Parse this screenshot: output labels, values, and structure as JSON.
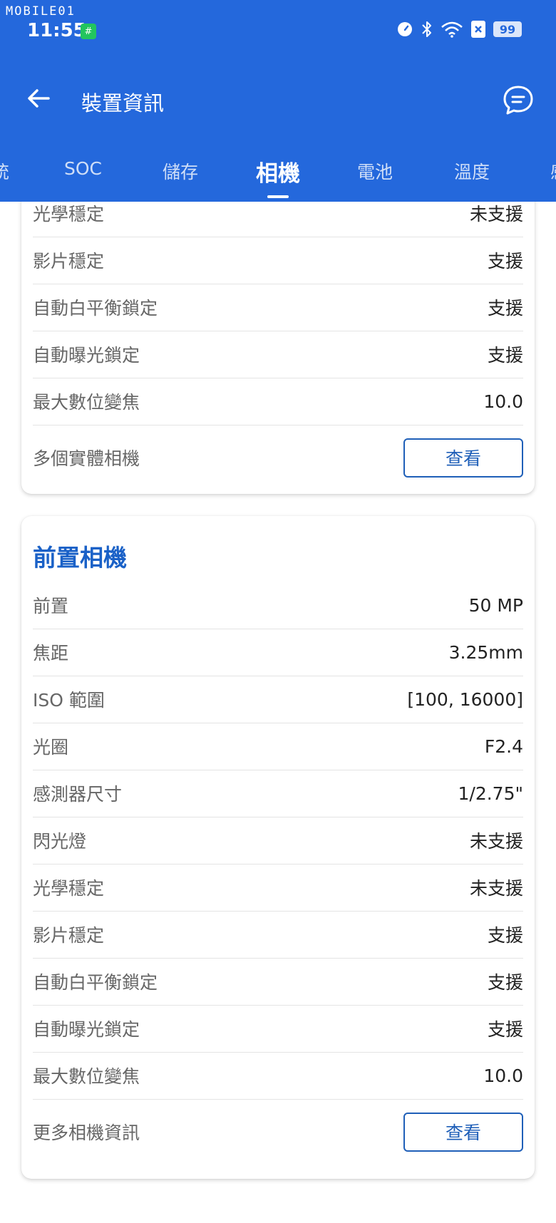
{
  "status": {
    "brand": "MOBILE01",
    "time": "11:55",
    "battery": "99",
    "icons": [
      "speed-icon",
      "bluetooth-icon",
      "wifi-icon",
      "sim-x-icon"
    ]
  },
  "toolbar": {
    "title": "裝置資訊"
  },
  "tabs": [
    "統",
    "SOC",
    "儲存",
    "相機",
    "電池",
    "溫度",
    "感"
  ],
  "active_tab": "相機",
  "top_card": {
    "rows": [
      {
        "label": "光學穩定",
        "value": "未支援"
      },
      {
        "label": "影片穩定",
        "value": "支援"
      },
      {
        "label": "自動白平衡鎖定",
        "value": "支援"
      },
      {
        "label": "自動曝光鎖定",
        "value": "支援"
      },
      {
        "label": "最大數位變焦",
        "value": "10.0"
      }
    ],
    "action": {
      "label": "多個實體相機",
      "button": "查看"
    }
  },
  "front_card": {
    "title": "前置相機",
    "rows": [
      {
        "label": "前置",
        "value": "50 MP"
      },
      {
        "label": "焦距",
        "value": "3.25mm"
      },
      {
        "label": "ISO 範圍",
        "value": "[100, 16000]"
      },
      {
        "label": "光圈",
        "value": "F2.4"
      },
      {
        "label": "感測器尺寸",
        "value": "1/2.75\""
      },
      {
        "label": "閃光燈",
        "value": "未支援"
      },
      {
        "label": "光學穩定",
        "value": "未支援"
      },
      {
        "label": "影片穩定",
        "value": "支援"
      },
      {
        "label": "自動白平衡鎖定",
        "value": "支援"
      },
      {
        "label": "自動曝光鎖定",
        "value": "支援"
      },
      {
        "label": "最大數位變焦",
        "value": "10.0"
      }
    ],
    "action": {
      "label": "更多相機資訊",
      "button": "查看"
    }
  },
  "colors": {
    "header": "#2468dc",
    "accent": "#1a61c7"
  }
}
